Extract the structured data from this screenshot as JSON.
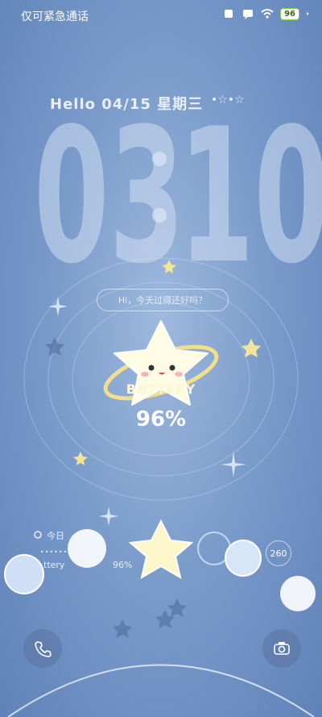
{
  "status": {
    "carrier": "仅可紧急通话",
    "battery": "96"
  },
  "lock": {
    "greeting": "Hello 04/15 星期三",
    "hours": "03",
    "minutes": "10",
    "bubble": "Hi，今天过得还好吗？"
  },
  "battery_widget": {
    "label": "BATTERY",
    "percent": "96%"
  },
  "widgets": {
    "today": "今日",
    "battery_label": "ttery",
    "battery_percent": "96%",
    "count": "260"
  },
  "colors": {
    "accent_star": "#f4e7a4",
    "battery_green": "#8ad14a"
  }
}
